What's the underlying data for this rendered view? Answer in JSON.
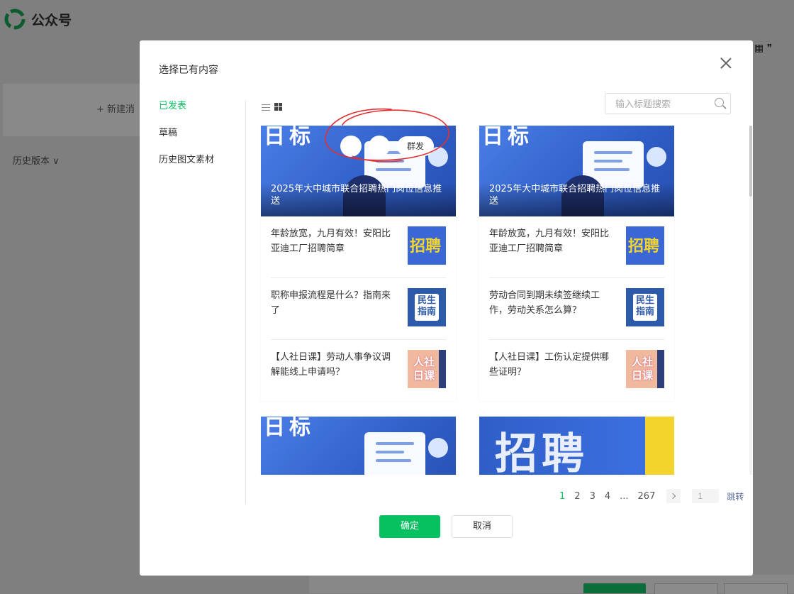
{
  "app": {
    "title": "公众号"
  },
  "background": {
    "new_label": "+ 新建消",
    "history_label": "历史版本 ∨",
    "right_icons": "▦ ❞"
  },
  "modal": {
    "title": "选择已有内容",
    "nav": [
      "已发表",
      "草稿",
      "历史图文素材"
    ],
    "search_placeholder": "输入标题搜索",
    "hover_action": "群发",
    "cards": [
      {
        "cover_title": "2025年大中城市联合招聘热门岗位信息推送",
        "cover_text": "日标",
        "items": [
          {
            "title": "年龄放宽，九月有效！安阳比亚迪工厂招聘简章",
            "thumb": "招聘"
          },
          {
            "title": "职称申报流程是什么？指南来了",
            "thumb": "民生指南"
          },
          {
            "title": "【人社日课】劳动人事争议调解能线上申请吗？",
            "thumb": "人社日课"
          }
        ]
      },
      {
        "cover_title": "2025年大中城市联合招聘热门岗位信息推送",
        "cover_text": "日标",
        "items": [
          {
            "title": "年龄放宽，九月有效！安阳比亚迪工厂招聘简章",
            "thumb": "招聘"
          },
          {
            "title": "劳动合同到期未续签继续工作，劳动关系怎么算？",
            "thumb": "民生指南"
          },
          {
            "title": "【人社日课】工伤认定提供哪些证明？",
            "thumb": "人社日课"
          }
        ]
      },
      {
        "cover_text": "日标"
      },
      {
        "cover_text": "招聘"
      }
    ],
    "pagination": {
      "pages": [
        "1",
        "2",
        "3",
        "4",
        "...",
        "267"
      ],
      "current": "1",
      "jump_value": "1",
      "jump_label": "跳转"
    },
    "confirm_label": "确定",
    "cancel_label": "取消"
  },
  "colors": {
    "accent": "#07c160",
    "link": "#576b95",
    "annotation": "#e03030"
  }
}
